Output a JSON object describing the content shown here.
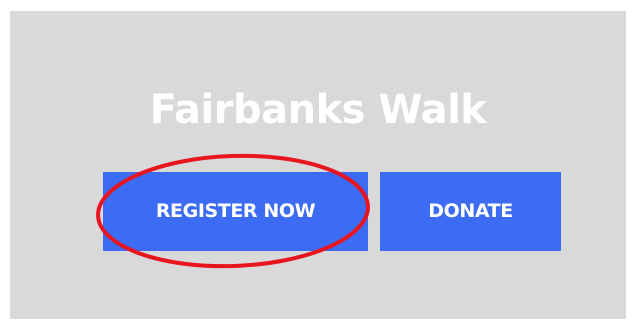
{
  "page": {
    "title": "Fairbanks Walk"
  },
  "buttons": {
    "register_label": "REGISTER NOW",
    "donate_label": "DONATE"
  },
  "colors": {
    "panel_background": "#d9d9d9",
    "button_background": "#3d6cf4",
    "text": "#ffffff",
    "highlight_ring": "#e8141e"
  }
}
